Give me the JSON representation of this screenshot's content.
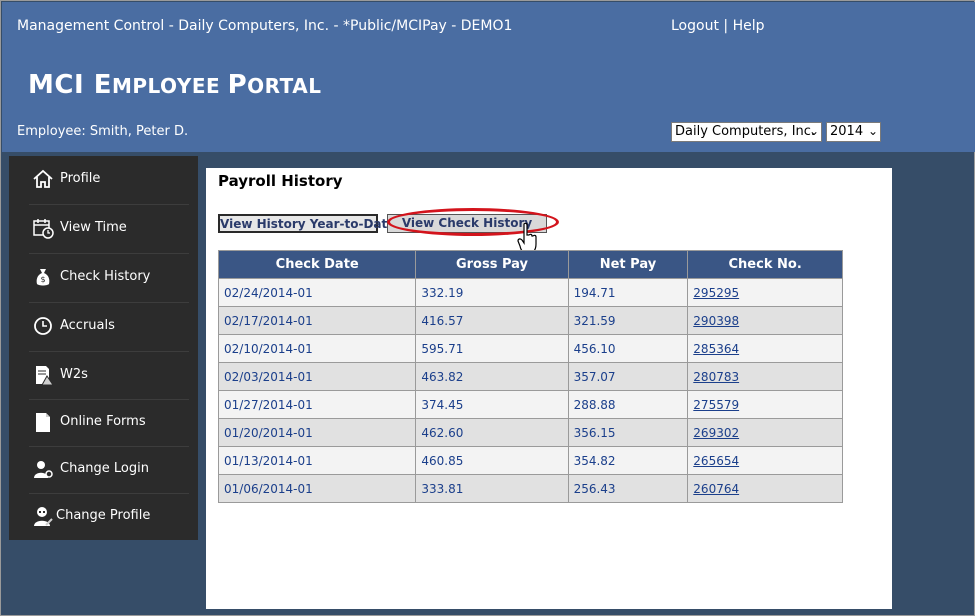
{
  "header": {
    "title": "Management Control - Daily Computers, Inc. - *Public/MCIPay - DEMO1",
    "logout": "Logout",
    "separator": "|",
    "help": "Help",
    "portal_title_first": "MCI ",
    "portal_title_big1": "E",
    "portal_title_small1": "MPLOYEE ",
    "portal_title_big2": "P",
    "portal_title_small2": "ORTAL",
    "employee": "Employee: Smith, Peter D.",
    "company_select": "Daily Computers, Inc.",
    "year_select": "2014"
  },
  "sidebar": {
    "items": [
      {
        "label": "Profile",
        "icon": "home-icon"
      },
      {
        "label": "View Time",
        "icon": "calendar-clock-icon"
      },
      {
        "label": "Check History",
        "icon": "money-bag-icon"
      },
      {
        "label": "Accruals",
        "icon": "clock-icon"
      },
      {
        "label": "W2s",
        "icon": "document-warning-icon"
      },
      {
        "label": "Online Forms",
        "icon": "document-icon"
      },
      {
        "label": "Change Login",
        "icon": "user-key-icon"
      },
      {
        "label": "Change Profile",
        "icon": "user-edit-icon"
      }
    ]
  },
  "main": {
    "title": "Payroll History",
    "btn_ytd": "View History Year-to-Date",
    "btn_check": "View Check History",
    "columns": [
      "Check Date",
      "Gross Pay",
      "Net Pay",
      "Check No."
    ],
    "rows": [
      [
        "02/24/2014-01",
        "332.19",
        "194.71",
        "295295"
      ],
      [
        "02/17/2014-01",
        "416.57",
        "321.59",
        "290398"
      ],
      [
        "02/10/2014-01",
        "595.71",
        "456.10",
        "285364"
      ],
      [
        "02/03/2014-01",
        "463.82",
        "357.07",
        "280783"
      ],
      [
        "01/27/2014-01",
        "374.45",
        "288.88",
        "275579"
      ],
      [
        "01/20/2014-01",
        "462.60",
        "356.15",
        "269302"
      ],
      [
        "01/13/2014-01",
        "460.85",
        "354.82",
        "265654"
      ],
      [
        "01/06/2014-01",
        "333.81",
        "256.43",
        "260764"
      ]
    ]
  },
  "colors": {
    "header_bg": "#4a6da2",
    "sidebar_bg": "#2b2b2b",
    "table_header_bg": "#3a5685",
    "highlight": "#d3141c",
    "link": "#1b3f8b"
  }
}
